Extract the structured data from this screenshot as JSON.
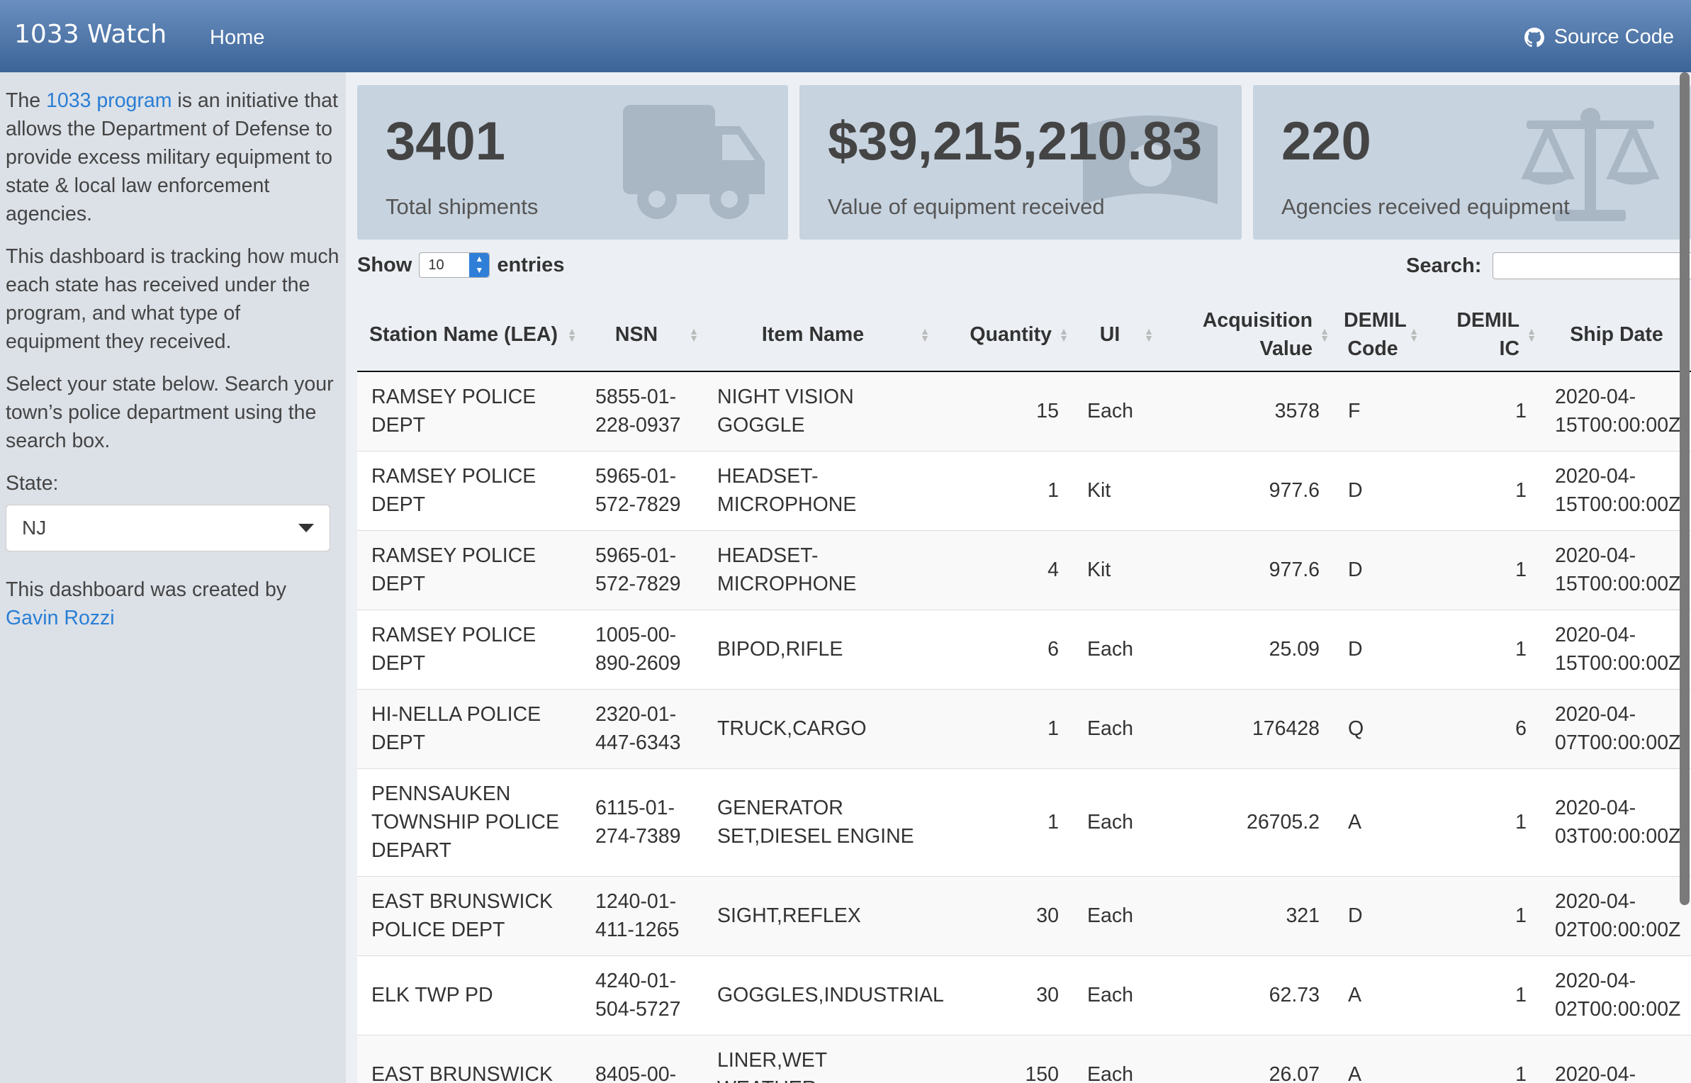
{
  "header": {
    "brand": "1033 Watch",
    "nav_home": "Home",
    "source_code": "Source Code"
  },
  "sidebar": {
    "intro_pre": "The ",
    "intro_link": "1033 program",
    "intro_post": " is an initiative that allows the Department of Defense to provide excess military equipment to state & local law enforcement agencies.",
    "tracking": "This dashboard is tracking how much each state has received under the program, and what type of equipment they received.",
    "instructions": "Select your state below. Search your town’s police department using the search box.",
    "state_label": "State:",
    "state_value": "NJ",
    "credit_pre": "This dashboard was created by",
    "credit_link": "Gavin Rozzi"
  },
  "stats": [
    {
      "value": "3401",
      "label": "Total shipments",
      "icon": "truck-icon"
    },
    {
      "value": "$39,215,210.83",
      "label": "Value of equipment received",
      "icon": "money-bill-icon"
    },
    {
      "value": "220",
      "label": "Agencies received equipment",
      "icon": "balance-scale-icon"
    }
  ],
  "table_controls": {
    "show": "Show",
    "length": "10",
    "entries": "entries",
    "search": "Search:"
  },
  "table": {
    "headers": [
      "Station Name (LEA)",
      "NSN",
      "Item Name",
      "Quantity",
      "UI",
      "Acquisition Value",
      "DEMIL Code",
      "DEMIL IC",
      "Ship Date"
    ],
    "rows": [
      [
        "RAMSEY POLICE DEPT",
        "5855-01-228-0937",
        "NIGHT VISION GOGGLE",
        "15",
        "Each",
        "3578",
        "F",
        "1",
        "2020-04-15T00:00:00Z"
      ],
      [
        "RAMSEY POLICE DEPT",
        "5965-01-572-7829",
        "HEADSET-MICROPHONE",
        "1",
        "Kit",
        "977.6",
        "D",
        "1",
        "2020-04-15T00:00:00Z"
      ],
      [
        "RAMSEY POLICE DEPT",
        "5965-01-572-7829",
        "HEADSET-MICROPHONE",
        "4",
        "Kit",
        "977.6",
        "D",
        "1",
        "2020-04-15T00:00:00Z"
      ],
      [
        "RAMSEY POLICE DEPT",
        "1005-00-890-2609",
        "BIPOD,RIFLE",
        "6",
        "Each",
        "25.09",
        "D",
        "1",
        "2020-04-15T00:00:00Z"
      ],
      [
        "HI-NELLA POLICE DEPT",
        "2320-01-447-6343",
        "TRUCK,CARGO",
        "1",
        "Each",
        "176428",
        "Q",
        "6",
        "2020-04-07T00:00:00Z"
      ],
      [
        "PENNSAUKEN TOWNSHIP POLICE DEPART",
        "6115-01-274-7389",
        "GENERATOR SET,DIESEL ENGINE",
        "1",
        "Each",
        "26705.2",
        "A",
        "1",
        "2020-04-03T00:00:00Z"
      ],
      [
        "EAST BRUNSWICK POLICE DEPT",
        "1240-01-411-1265",
        "SIGHT,REFLEX",
        "30",
        "Each",
        "321",
        "D",
        "1",
        "2020-04-02T00:00:00Z"
      ],
      [
        "ELK TWP PD",
        "4240-01-504-5727",
        "GOGGLES,INDUSTRIAL",
        "30",
        "Each",
        "62.73",
        "A",
        "1",
        "2020-04-02T00:00:00Z"
      ],
      [
        "EAST BRUNSWICK",
        "8405-00-",
        "LINER,WET WEATHER",
        "150",
        "Each",
        "26.07",
        "A",
        "1",
        "2020-04-"
      ]
    ]
  }
}
